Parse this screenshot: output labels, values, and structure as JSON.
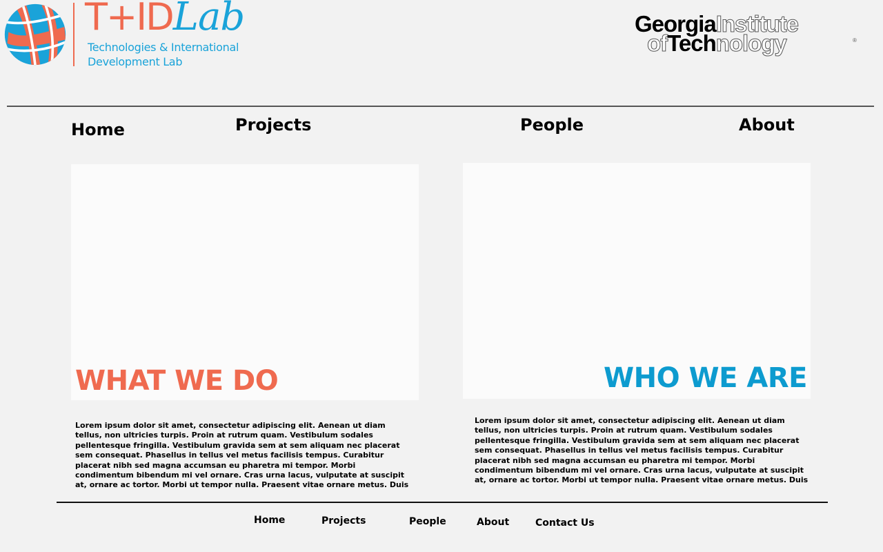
{
  "header": {
    "logo": {
      "name_part1": "T+ID",
      "name_part2": "Lab",
      "tagline_line1": "Technologies & International",
      "tagline_line2": "Development Lab",
      "colors": {
        "orange": "#ef6a4f",
        "blue": "#1aa3d9"
      }
    },
    "partner_logo": {
      "line1_black": "Georgia",
      "line1_outline": "Institute",
      "line2_outline_a": "of",
      "line2_black": "Tech",
      "line2_outline_b": "nology",
      "registered_mark": "®"
    }
  },
  "top_nav": {
    "home": "Home",
    "projects": "Projects",
    "people": "People",
    "about": "About"
  },
  "sections": {
    "what_we_do": {
      "title": "WHAT WE DO",
      "title_color": "#ef6a4f",
      "body": "Lorem ipsum dolor sit amet, consectetur adipiscing elit. Aenean ut diam tellus, non ultricies turpis. Proin at rutrum quam. Vestibulum sodales pellentesque fringilla. Vestibulum gravida sem at sem aliquam nec placerat sem consequat. Phasellus in tellus vel metus facilisis tempus. Curabitur placerat nibh sed magna accumsan eu pharetra mi tempor. Morbi condimentum bibendum mi vel ornare. Cras urna lacus, vulputate at suscipit at, ornare ac tortor. Morbi ut tempor nulla. Praesent vitae ornare metus. Duis venenatis pulvinar semper. Pellentesque habitant morbi tristique"
    },
    "who_we_are": {
      "title": "WHO WE ARE",
      "title_color": "#0d9bcf",
      "body": "Lorem ipsum dolor sit amet, consectetur adipiscing elit. Aenean ut diam tellus, non ultricies turpis. Proin at rutrum quam. Vestibulum sodales pellentesque fringilla. Vestibulum gravida sem at sem aliquam nec placerat sem consequat. Phasellus in tellus vel metus facilisis tempus. Curabitur placerat nibh sed magna accumsan eu pharetra mi tempor. Morbi condimentum bibendum mi vel ornare. Cras urna lacus, vulputate at suscipit at, ornare ac tortor. Morbi ut tempor nulla. Praesent vitae ornare metus. Duis venenatis pulvinar semper. Pellentesque habitant morbi tristique"
    }
  },
  "footer_nav": {
    "home": "Home",
    "projects": "Projects",
    "people": "People",
    "about": "About",
    "contact": "Contact Us"
  }
}
